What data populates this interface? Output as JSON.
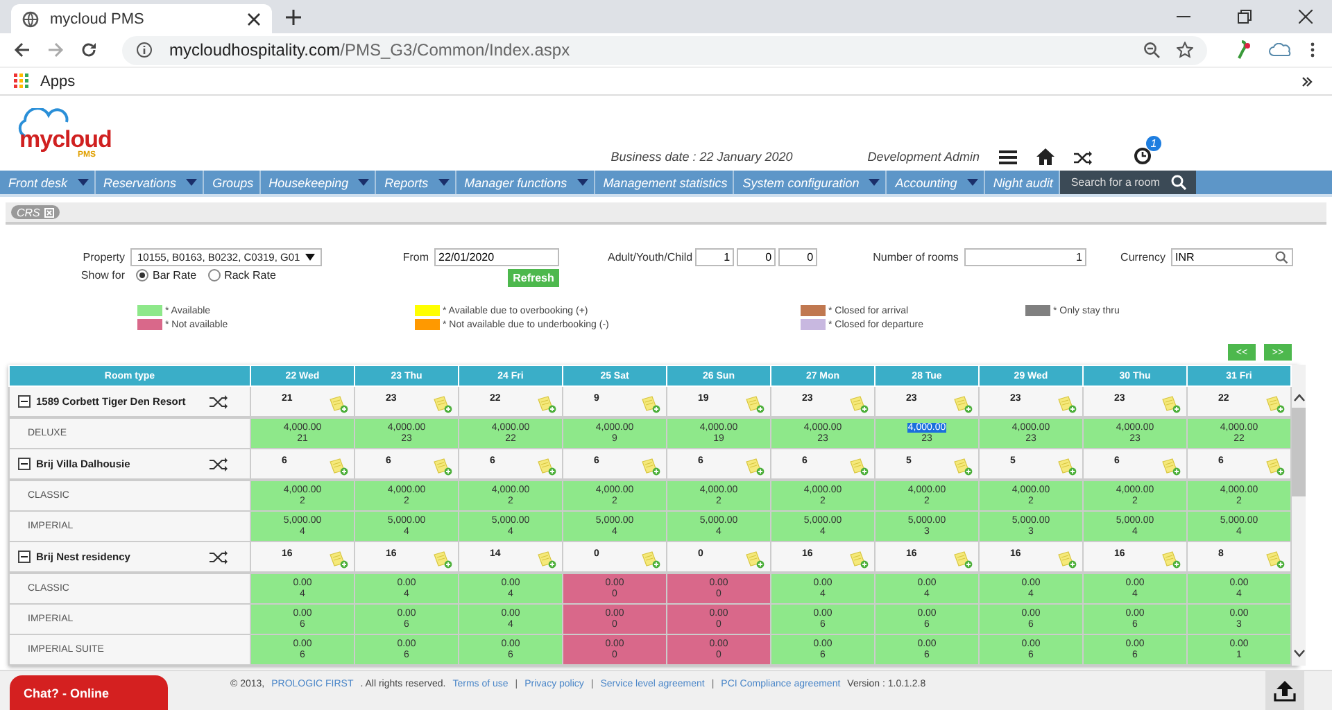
{
  "browser": {
    "tab_title": "mycloud PMS",
    "url_host": "mycloudhospitality.com",
    "url_path": "/PMS_G3/Common/Index.aspx",
    "bookmarks": [
      "Apps"
    ]
  },
  "header": {
    "logo": "mycloud",
    "logo_sub": "PMS",
    "business_date": "Business date : 22 January 2020",
    "user": "Development Admin",
    "notification_count": "1"
  },
  "menu": {
    "items": [
      {
        "label": "Front desk",
        "dropdown": true
      },
      {
        "label": "Reservations",
        "dropdown": true
      },
      {
        "label": "Groups",
        "dropdown": false
      },
      {
        "label": "Housekeeping",
        "dropdown": true
      },
      {
        "label": "Reports",
        "dropdown": true
      },
      {
        "label": "Manager functions",
        "dropdown": true
      },
      {
        "label": "Management statistics",
        "dropdown": false
      },
      {
        "label": "System configuration",
        "dropdown": true
      },
      {
        "label": "Accounting",
        "dropdown": true
      },
      {
        "label": "Night audit",
        "dropdown": false
      }
    ],
    "search_placeholder": "Search for a room"
  },
  "open_tabs": [
    {
      "label": "CRS"
    }
  ],
  "filters": {
    "property_label": "Property",
    "property_value": "10155, B0163, B0232, C0319, G01",
    "from_label": "From",
    "from_value": "22/01/2020",
    "refresh": "Refresh",
    "guests_label": "Adult/Youth/Child",
    "guests": [
      "1",
      "0",
      "0"
    ],
    "rooms_label": "Number of rooms",
    "rooms_value": "1",
    "currency_label": "Currency",
    "currency_value": "INR",
    "show_for_label": "Show for",
    "rate_options": [
      {
        "label": "Bar Rate",
        "selected": true
      },
      {
        "label": "Rack Rate",
        "selected": false
      }
    ]
  },
  "legend": [
    {
      "label": "* Available",
      "color": "#8ee88a"
    },
    {
      "label": "* Not available",
      "color": "#d9688a"
    },
    {
      "label": "* Available due to overbooking (+)",
      "color": "#ffff00"
    },
    {
      "label": "* Not available due to underbooking (-)",
      "color": "#ff9900"
    },
    {
      "label": "* Closed for arrival",
      "color": "#c07850"
    },
    {
      "label": "* Closed for departure",
      "color": "#c8b8e0"
    },
    {
      "label": "* Only stay thru",
      "color": "#808080"
    }
  ],
  "pager": [
    "<<",
    ">>"
  ],
  "grid": {
    "columns": [
      "Room type",
      "22 Wed",
      "23 Thu",
      "24 Fri",
      "25 Sat",
      "26 Sun",
      "27 Mon",
      "28 Tue",
      "29 Wed",
      "30 Thu",
      "31 Fri"
    ],
    "groups": [
      {
        "name": "1589 Corbett Tiger Den Resort",
        "expanded": true,
        "counts": [
          "21",
          "23",
          "22",
          "9",
          "19",
          "23",
          "23",
          "23",
          "23",
          "22"
        ],
        "rooms": [
          {
            "name": "DELUXE",
            "cells": [
              {
                "rate": "4,000.00",
                "count": "21",
                "available": true,
                "selected": false
              },
              {
                "rate": "4,000.00",
                "count": "23",
                "available": true,
                "selected": false
              },
              {
                "rate": "4,000.00",
                "count": "22",
                "available": true,
                "selected": false
              },
              {
                "rate": "4,000.00",
                "count": "9",
                "available": true,
                "selected": false
              },
              {
                "rate": "4,000.00",
                "count": "19",
                "available": true,
                "selected": false
              },
              {
                "rate": "4,000.00",
                "count": "23",
                "available": true,
                "selected": false
              },
              {
                "rate": "4,000.00",
                "count": "23",
                "available": true,
                "selected": true
              },
              {
                "rate": "4,000.00",
                "count": "23",
                "available": true,
                "selected": false
              },
              {
                "rate": "4,000.00",
                "count": "23",
                "available": true,
                "selected": false
              },
              {
                "rate": "4,000.00",
                "count": "22",
                "available": true,
                "selected": false
              }
            ]
          }
        ]
      },
      {
        "name": "Brij Villa Dalhousie",
        "expanded": true,
        "counts": [
          "6",
          "6",
          "6",
          "6",
          "6",
          "6",
          "5",
          "5",
          "6",
          "6"
        ],
        "rooms": [
          {
            "name": "CLASSIC",
            "cells": [
              {
                "rate": "4,000.00",
                "count": "2",
                "available": true,
                "selected": false
              },
              {
                "rate": "4,000.00",
                "count": "2",
                "available": true,
                "selected": false
              },
              {
                "rate": "4,000.00",
                "count": "2",
                "available": true,
                "selected": false
              },
              {
                "rate": "4,000.00",
                "count": "2",
                "available": true,
                "selected": false
              },
              {
                "rate": "4,000.00",
                "count": "2",
                "available": true,
                "selected": false
              },
              {
                "rate": "4,000.00",
                "count": "2",
                "available": true,
                "selected": false
              },
              {
                "rate": "4,000.00",
                "count": "2",
                "available": true,
                "selected": false
              },
              {
                "rate": "4,000.00",
                "count": "2",
                "available": true,
                "selected": false
              },
              {
                "rate": "4,000.00",
                "count": "2",
                "available": true,
                "selected": false
              },
              {
                "rate": "4,000.00",
                "count": "2",
                "available": true,
                "selected": false
              }
            ]
          },
          {
            "name": "IMPERIAL",
            "cells": [
              {
                "rate": "5,000.00",
                "count": "4",
                "available": true,
                "selected": false
              },
              {
                "rate": "5,000.00",
                "count": "4",
                "available": true,
                "selected": false
              },
              {
                "rate": "5,000.00",
                "count": "4",
                "available": true,
                "selected": false
              },
              {
                "rate": "5,000.00",
                "count": "4",
                "available": true,
                "selected": false
              },
              {
                "rate": "5,000.00",
                "count": "4",
                "available": true,
                "selected": false
              },
              {
                "rate": "5,000.00",
                "count": "4",
                "available": true,
                "selected": false
              },
              {
                "rate": "5,000.00",
                "count": "3",
                "available": true,
                "selected": false
              },
              {
                "rate": "5,000.00",
                "count": "3",
                "available": true,
                "selected": false
              },
              {
                "rate": "5,000.00",
                "count": "4",
                "available": true,
                "selected": false
              },
              {
                "rate": "5,000.00",
                "count": "4",
                "available": true,
                "selected": false
              }
            ]
          }
        ]
      },
      {
        "name": "Brij Nest residency",
        "expanded": true,
        "counts": [
          "16",
          "16",
          "14",
          "0",
          "0",
          "16",
          "16",
          "16",
          "16",
          "8"
        ],
        "rooms": [
          {
            "name": "CLASSIC",
            "cells": [
              {
                "rate": "0.00",
                "count": "4",
                "available": true,
                "selected": false
              },
              {
                "rate": "0.00",
                "count": "4",
                "available": true,
                "selected": false
              },
              {
                "rate": "0.00",
                "count": "4",
                "available": true,
                "selected": false
              },
              {
                "rate": "0.00",
                "count": "0",
                "available": false,
                "selected": false
              },
              {
                "rate": "0.00",
                "count": "0",
                "available": false,
                "selected": false
              },
              {
                "rate": "0.00",
                "count": "4",
                "available": true,
                "selected": false
              },
              {
                "rate": "0.00",
                "count": "4",
                "available": true,
                "selected": false
              },
              {
                "rate": "0.00",
                "count": "4",
                "available": true,
                "selected": false
              },
              {
                "rate": "0.00",
                "count": "4",
                "available": true,
                "selected": false
              },
              {
                "rate": "0.00",
                "count": "4",
                "available": true,
                "selected": false
              }
            ]
          },
          {
            "name": "IMPERIAL",
            "cells": [
              {
                "rate": "0.00",
                "count": "6",
                "available": true,
                "selected": false
              },
              {
                "rate": "0.00",
                "count": "6",
                "available": true,
                "selected": false
              },
              {
                "rate": "0.00",
                "count": "4",
                "available": true,
                "selected": false
              },
              {
                "rate": "0.00",
                "count": "0",
                "available": false,
                "selected": false
              },
              {
                "rate": "0.00",
                "count": "0",
                "available": false,
                "selected": false
              },
              {
                "rate": "0.00",
                "count": "6",
                "available": true,
                "selected": false
              },
              {
                "rate": "0.00",
                "count": "6",
                "available": true,
                "selected": false
              },
              {
                "rate": "0.00",
                "count": "6",
                "available": true,
                "selected": false
              },
              {
                "rate": "0.00",
                "count": "6",
                "available": true,
                "selected": false
              },
              {
                "rate": "0.00",
                "count": "3",
                "available": true,
                "selected": false
              }
            ]
          },
          {
            "name": "IMPERIAL SUITE",
            "cells": [
              {
                "rate": "0.00",
                "count": "6",
                "available": true,
                "selected": false
              },
              {
                "rate": "0.00",
                "count": "6",
                "available": true,
                "selected": false
              },
              {
                "rate": "0.00",
                "count": "6",
                "available": true,
                "selected": false
              },
              {
                "rate": "0.00",
                "count": "0",
                "available": false,
                "selected": false
              },
              {
                "rate": "0.00",
                "count": "0",
                "available": false,
                "selected": false
              },
              {
                "rate": "0.00",
                "count": "6",
                "available": true,
                "selected": false
              },
              {
                "rate": "0.00",
                "count": "6",
                "available": true,
                "selected": false
              },
              {
                "rate": "0.00",
                "count": "6",
                "available": true,
                "selected": false
              },
              {
                "rate": "0.00",
                "count": "6",
                "available": true,
                "selected": false
              },
              {
                "rate": "0.00",
                "count": "1",
                "available": true,
                "selected": false
              }
            ]
          }
        ]
      }
    ]
  },
  "footer": {
    "copyright": "© 2013,",
    "company": "PROLOGIC FIRST",
    "rights": ". All rights reserved.",
    "separator": "|",
    "links": [
      "Terms of use",
      "Privacy policy",
      "Service level agreement",
      "PCI Compliance agreement"
    ],
    "version": "Version : 1.0.1.2.8",
    "chat": "Chat? - Online"
  }
}
